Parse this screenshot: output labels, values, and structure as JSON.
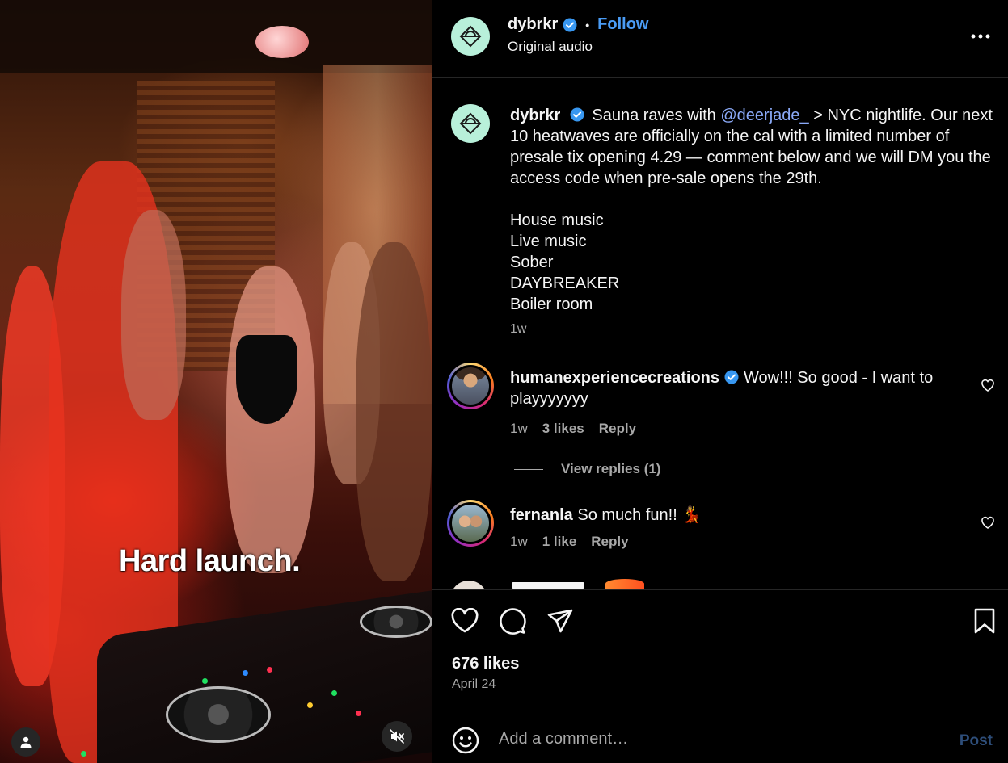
{
  "media": {
    "overlay_caption": "Hard launch.",
    "icons": [
      "user-tag-icon",
      "muted-speaker-icon"
    ]
  },
  "header": {
    "username": "dybrkr",
    "separator": "•",
    "follow_label": "Follow",
    "audio_label": "Original audio",
    "icons": [
      "verified-icon",
      "more-options-icon"
    ]
  },
  "caption": {
    "username": "dybrkr",
    "text_before_mention": "Sauna raves with",
    "mention": "@deerjade_",
    "text_after_mention": "> NYC nightlife. Our next 10 heatwaves are officially on the cal with a limited number of presale tix opening 4.29 — comment below and we will DM you the access code when pre-sale opens the 29th.",
    "list": [
      "House music",
      "Live music",
      "Sober",
      "DAYBREAKER",
      "Boiler room"
    ],
    "time": "1w"
  },
  "comments": [
    {
      "username": "humanexperiencecreations",
      "verified": true,
      "text": "Wow!!! So good - I want to playyyyyyy",
      "time": "1w",
      "likes": "3 likes",
      "reply_label": "Reply",
      "view_replies": "View replies (1)"
    },
    {
      "username": "fernanla",
      "verified": false,
      "text": "So much fun!! 💃",
      "time": "1w",
      "likes": "1 like",
      "reply_label": "Reply"
    }
  ],
  "actions": {
    "likes": "676 likes",
    "date": "April 24",
    "icons": [
      "heart-icon",
      "comment-icon",
      "share-icon",
      "bookmark-icon"
    ]
  },
  "composer": {
    "placeholder": "Add a comment…",
    "post_label": "Post",
    "icon": "emoji-icon"
  },
  "colors": {
    "background": "#000000",
    "link_blue": "#4a9cf5",
    "mention_blue": "#8aa9f7",
    "muted_text": "#a8a8a8",
    "avatar_mint": "#b8f0da",
    "post_disabled": "#2e4e7a"
  }
}
